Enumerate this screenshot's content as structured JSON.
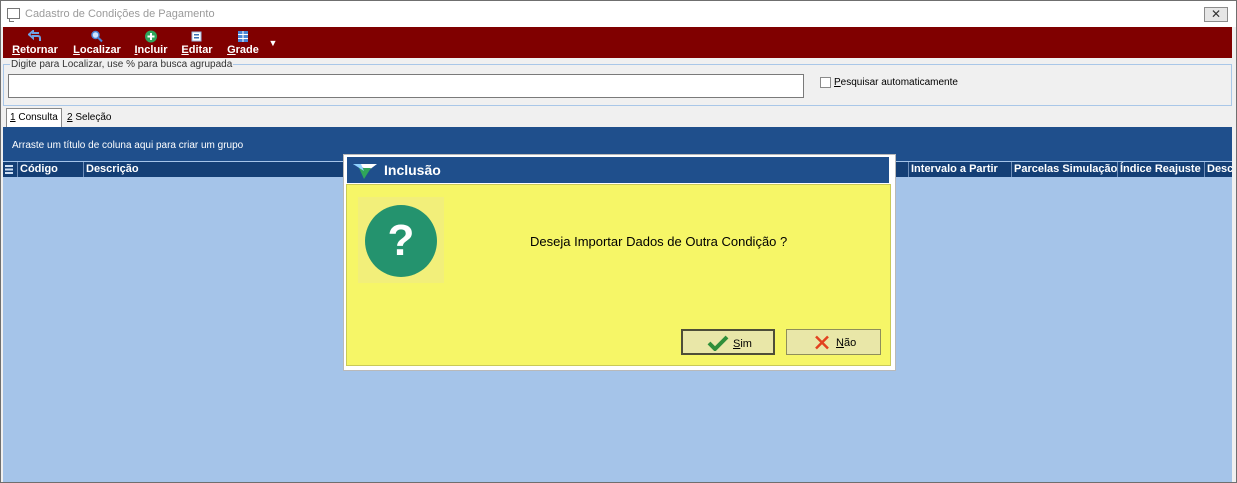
{
  "window": {
    "title": "Cadastro de Condições de Pagamento",
    "close_glyph": "✕"
  },
  "toolbar": {
    "items": [
      {
        "key": "R",
        "rest": "etornar",
        "icon": "return-arrow-icon"
      },
      {
        "key": "L",
        "rest": "ocalizar",
        "icon": "magnifier-icon"
      },
      {
        "key": "I",
        "rest": "ncluir",
        "icon": "plus-circle-icon"
      },
      {
        "key": "E",
        "rest": "ditar",
        "icon": "edit-form-icon"
      },
      {
        "key": "G",
        "rest": "rade",
        "icon": "grid-icon"
      }
    ],
    "more_glyph": "▼",
    "background": "#800000"
  },
  "search": {
    "legend": "Digite para Localizar, use % para busca agrupada",
    "value": "",
    "auto_key": "P",
    "auto_rest": "esquisar automaticamente",
    "auto_checked": false
  },
  "tabs": [
    {
      "key": "1",
      "rest": " Consulta",
      "active": true
    },
    {
      "key": "2",
      "rest": " Seleção",
      "active": false
    }
  ],
  "grid": {
    "group_hint": "Arraste um título de coluna aqui para criar um grupo",
    "columns": [
      "Código",
      "Descrição",
      "Intervalo a Partir",
      "Parcelas Simulação",
      "Índice Reajuste",
      "Desc"
    ]
  },
  "dialog": {
    "title": "Inclusão",
    "icon_glyph": "?",
    "message": "Deseja Importar Dados de Outra Condição ?",
    "yes_key": "S",
    "yes_rest": "im",
    "no_key": "N",
    "no_rest": "ão"
  },
  "colors": {
    "dialog_title": "#1f4f8c",
    "dialog_body": "#f6f667",
    "grid_background": "#a5c4e9",
    "question_icon": "#24936e"
  }
}
